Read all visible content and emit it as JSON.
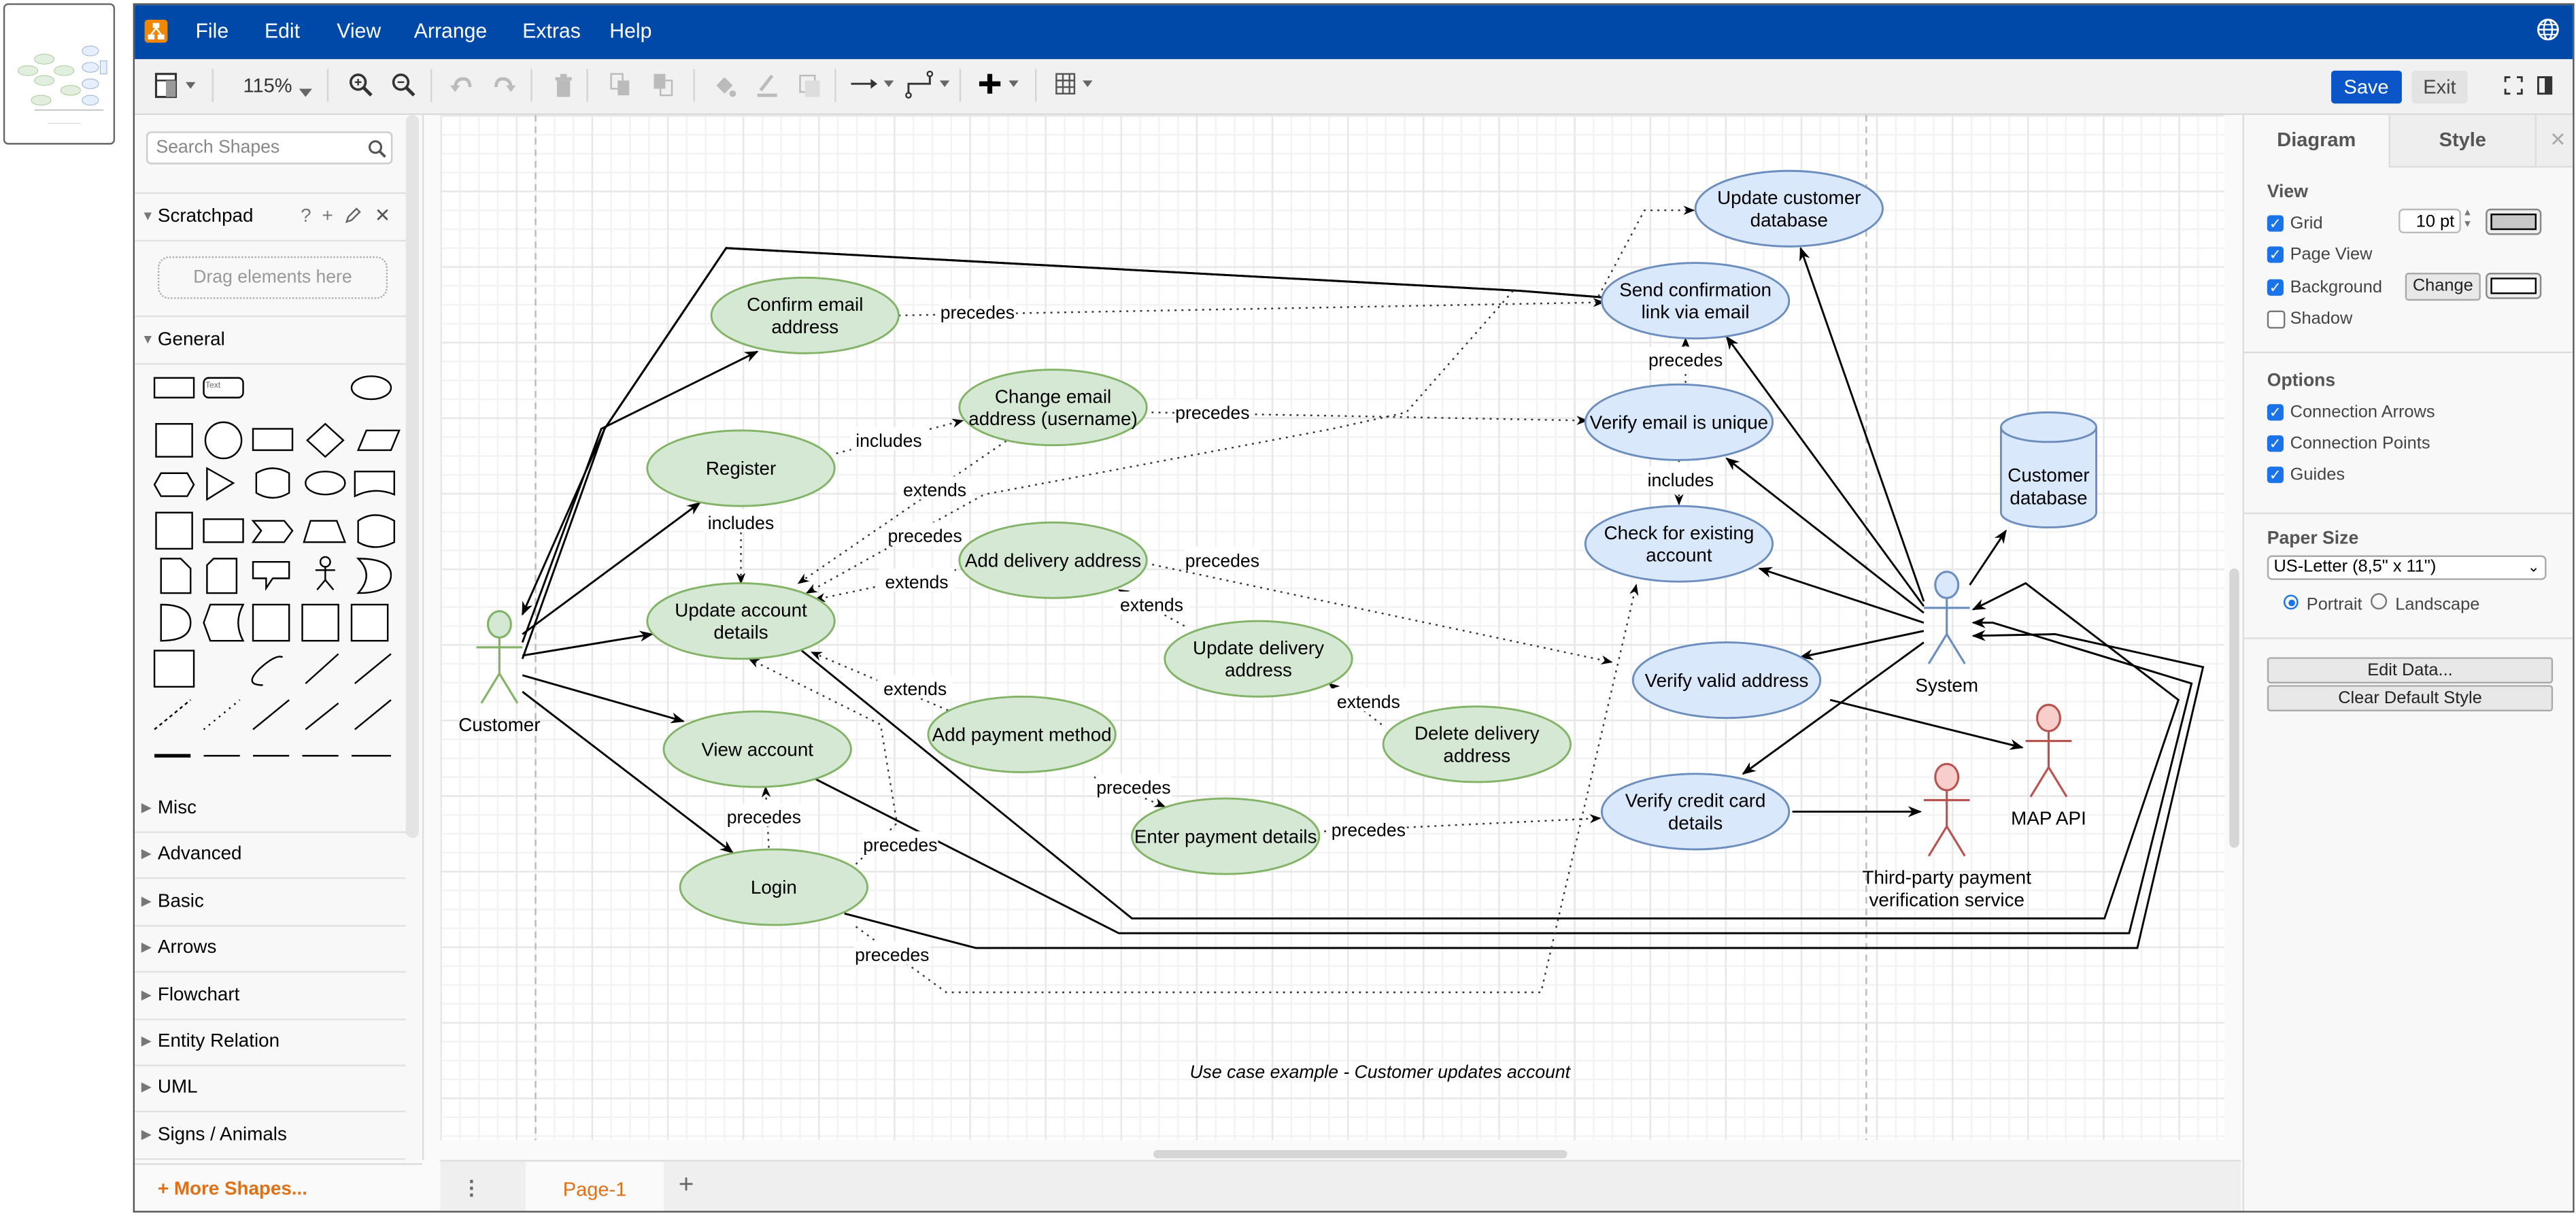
{
  "thumbnail": {
    "label": "page-thumbnail"
  },
  "menubar": {
    "items": [
      "File",
      "Edit",
      "View",
      "Arrange",
      "Extras",
      "Help"
    ],
    "globe_icon": "globe-icon"
  },
  "toolbar": {
    "zoom": "115%",
    "save_label": "Save",
    "exit_label": "Exit",
    "icons": [
      "format-panel-icon",
      "zoom-in-icon",
      "zoom-out-icon",
      "undo-icon",
      "redo-icon",
      "delete-icon",
      "to-front-icon",
      "to-back-icon",
      "fill-color-icon",
      "line-color-icon",
      "shadow-icon",
      "connection-icon",
      "waypoints-icon",
      "insert-icon",
      "table-icon",
      "fullscreen-icon",
      "panel-toggle-icon"
    ]
  },
  "sidebar": {
    "search_placeholder": "Search Shapes",
    "scratchpad": {
      "title": "Scratchpad",
      "help": "?",
      "add": "+",
      "drop_hint": "Drag elements here"
    },
    "general_title": "General",
    "text_shape": "Text",
    "sections": [
      "Misc",
      "Advanced",
      "Basic",
      "Arrows",
      "Flowchart",
      "Entity Relation",
      "UML",
      "Signs / Animals"
    ],
    "more_shapes": "+ More Shapes..."
  },
  "pages": {
    "tabs": [
      "Page-1"
    ],
    "add": "+"
  },
  "panel": {
    "tabs": [
      "Diagram",
      "Style"
    ],
    "close": "✕",
    "view": {
      "title": "View",
      "grid": {
        "label": "Grid",
        "checked": true,
        "size": "10 pt",
        "color": "#c8c8c8"
      },
      "page_view": {
        "label": "Page View",
        "checked": true
      },
      "background": {
        "label": "Background",
        "checked": true,
        "button": "Change",
        "color": "#ffffff"
      },
      "shadow": {
        "label": "Shadow",
        "checked": false
      }
    },
    "options": {
      "title": "Options",
      "items": [
        {
          "label": "Connection Arrows",
          "checked": true
        },
        {
          "label": "Connection Points",
          "checked": true
        },
        {
          "label": "Guides",
          "checked": true
        }
      ]
    },
    "paper": {
      "title": "Paper Size",
      "selected": "US-Letter (8,5\" x 11\")",
      "orientation": {
        "portrait": "Portrait",
        "landscape": "Landscape",
        "selected": "Portrait"
      }
    },
    "buttons": {
      "edit_data": "Edit Data...",
      "clear_style": "Clear Default Style"
    }
  },
  "diagram": {
    "colors": {
      "green_fill": "#d5e8d4",
      "green_stroke": "#82b366",
      "blue_fill": "#dae8fc",
      "blue_stroke": "#6c8ebf",
      "red_stroke": "#b85450",
      "red_fill": "#f8cecc"
    },
    "caption": "Use case example - Customer updates account",
    "actors": {
      "customer": "Customer",
      "system": "System",
      "map_api": "MAP API",
      "payment": [
        "Third-party payment",
        "verification service"
      ]
    },
    "database": [
      "Customer",
      "database"
    ],
    "usecases": {
      "confirm_email": [
        "Confirm email",
        "address"
      ],
      "register": [
        "Register"
      ],
      "change_email": [
        "Change email",
        "address (username)"
      ],
      "update_account": [
        "Update account",
        "details"
      ],
      "add_delivery": [
        "Add delivery address"
      ],
      "update_delivery": [
        "Update delivery",
        "address"
      ],
      "delete_delivery": [
        "Delete delivery",
        "address"
      ],
      "add_payment": [
        "Add payment method"
      ],
      "enter_payment": [
        "Enter payment details"
      ],
      "view_account": [
        "View account"
      ],
      "login": [
        "Login"
      ],
      "update_db": [
        "Update customer",
        "database"
      ],
      "send_confirm": [
        "Send confirmation",
        "link via email"
      ],
      "verify_unique": [
        "Verify email is unique"
      ],
      "check_existing": [
        "Check for existing",
        "account"
      ],
      "verify_address": [
        "Verify valid address"
      ],
      "verify_card": [
        "Verify credit card",
        "details"
      ]
    },
    "edge_labels": {
      "precedes": "precedes",
      "includes": "includes",
      "extends": "extends"
    }
  }
}
